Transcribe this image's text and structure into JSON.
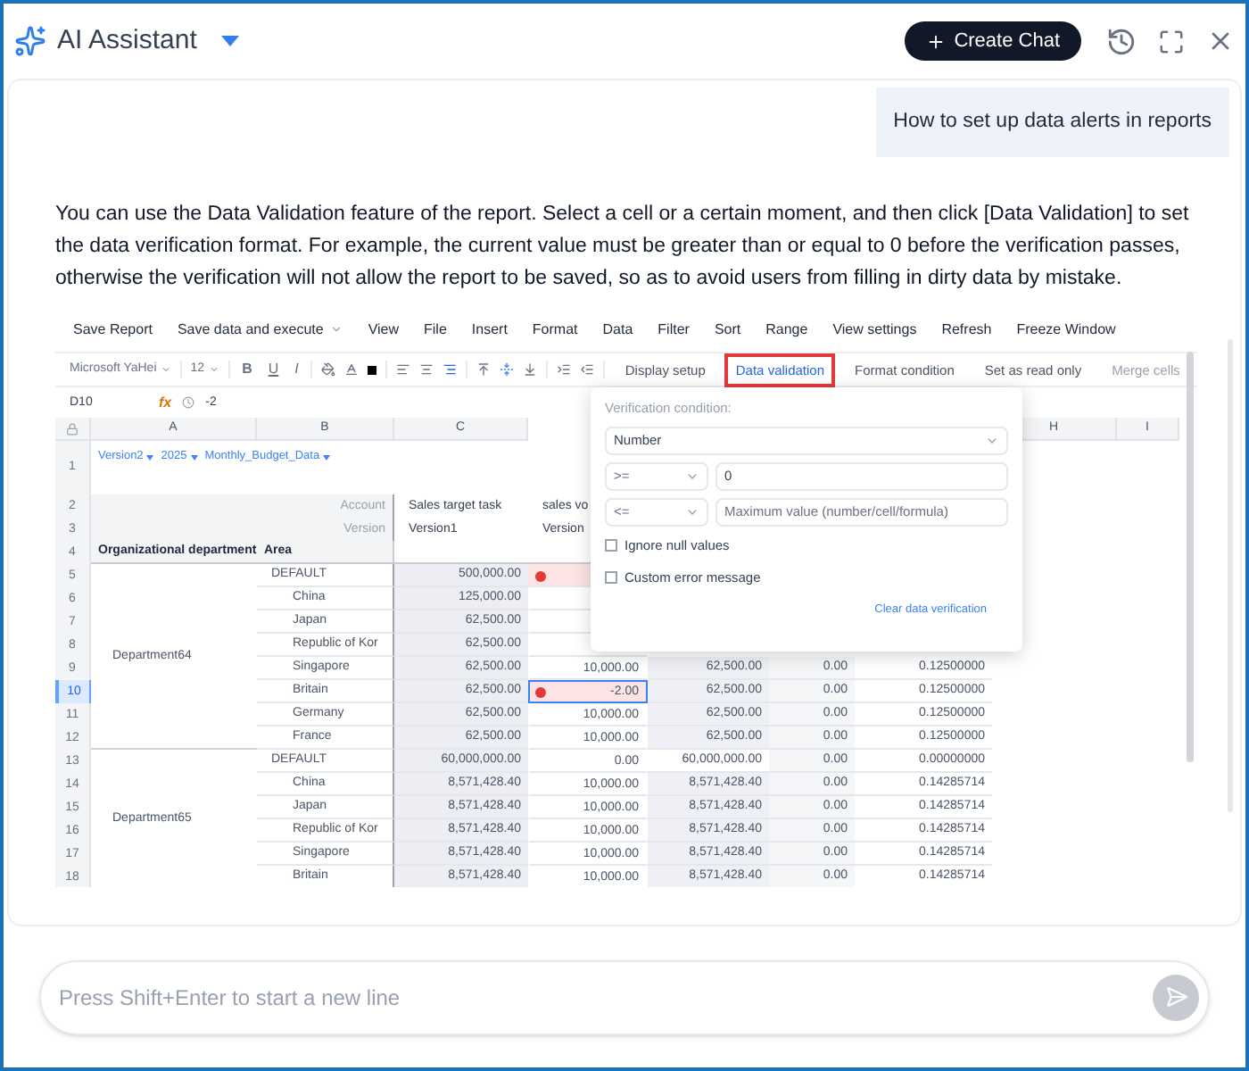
{
  "header": {
    "title": "AI Assistant",
    "create_chat": "Create Chat"
  },
  "chat": {
    "user_message": "How to set up data alerts in reports",
    "answer": "You can use the Data Validation feature of the report. Select a cell or a certain moment, and then click [Data Validation] to set the data verification format. For example, the current value must be greater than or equal to 0 before the verification passes, otherwise the verification will not allow the report to be saved, so as to avoid users from filling in dirty data by mistake.",
    "sheet": {
      "menu": [
        {
          "label": "Save Report",
          "dropdown": false
        },
        {
          "label": "Save data and execute",
          "dropdown": true
        },
        {
          "label": "View",
          "dropdown": false
        },
        {
          "label": "File",
          "dropdown": false
        },
        {
          "label": "Insert",
          "dropdown": false
        },
        {
          "label": "Format",
          "dropdown": false
        },
        {
          "label": "Data",
          "dropdown": false
        },
        {
          "label": "Filter",
          "dropdown": false
        },
        {
          "label": "Sort",
          "dropdown": false
        },
        {
          "label": "Range",
          "dropdown": false
        },
        {
          "label": "View settings",
          "dropdown": false
        },
        {
          "label": "Refresh",
          "dropdown": false
        },
        {
          "label": "Freeze Window",
          "dropdown": false
        }
      ],
      "font": "Microsoft YaHei",
      "font_size": "12",
      "format_buttons": [
        "B",
        "U",
        "I"
      ],
      "tools": [
        {
          "label": "Display setup",
          "selected": false,
          "disabled": false
        },
        {
          "label": "Data validation",
          "selected": true,
          "disabled": false
        },
        {
          "label": "Format condition",
          "selected": false,
          "disabled": false
        },
        {
          "label": "Set as read only",
          "selected": false,
          "disabled": false
        },
        {
          "label": "Merge cells",
          "selected": false,
          "disabled": true
        }
      ],
      "cell_ref": "D10",
      "fx_label": "fx",
      "formula": "-2",
      "columns": [
        {
          "kind": "letter",
          "label": "A"
        },
        {
          "kind": "letter",
          "label": "B"
        },
        {
          "kind": "letter",
          "label": "C"
        },
        {
          "kind": "covered"
        },
        {
          "kind": "covered"
        },
        {
          "kind": "covered"
        },
        {
          "kind": "covered"
        },
        {
          "kind": "letter",
          "label": "H"
        },
        {
          "kind": "letter",
          "label": "I"
        }
      ],
      "filter_row": {
        "number": "1",
        "filters": [
          "Version2",
          "2025",
          "Monthly_Budget_Data"
        ]
      },
      "header_rows": [
        {
          "number": "2",
          "b": "Account",
          "c": "Sales target task",
          "d": "sales vo"
        },
        {
          "number": "3",
          "b": "Version",
          "c": "Version1",
          "d": "Version"
        },
        {
          "number": "4",
          "a": "Organizational department",
          "b": "Area"
        }
      ],
      "groups": [
        {
          "department": "Department64",
          "rows": [
            {
              "number": "5",
              "kind": "default",
              "area": "DEFAULT",
              "values": [
                "500,000.00"
              ],
              "error": true,
              "selected": false
            },
            {
              "number": "6",
              "kind": "area",
              "area": "China",
              "values": [
                "125,000.00"
              ],
              "error": false,
              "selected": false
            },
            {
              "number": "7",
              "kind": "area",
              "area": "Japan",
              "values": [
                "62,500.00"
              ],
              "error": false,
              "selected": false
            },
            {
              "number": "8",
              "kind": "area",
              "area": "Republic of Kor",
              "values": [
                "62,500.00"
              ],
              "error": false,
              "selected": false
            },
            {
              "number": "9",
              "kind": "area",
              "area": "Singapore",
              "values": [
                "62,500.00",
                "10,000.00",
                "62,500.00",
                "0.00",
                "0.12500000"
              ],
              "error": false,
              "selected": false
            },
            {
              "number": "10",
              "kind": "area",
              "area": "Britain",
              "values": [
                "62,500.00",
                "-2.00",
                "62,500.00",
                "0.00",
                "0.12500000"
              ],
              "error": true,
              "selected": true
            },
            {
              "number": "11",
              "kind": "area",
              "area": "Germany",
              "values": [
                "62,500.00",
                "10,000.00",
                "62,500.00",
                "0.00",
                "0.12500000"
              ],
              "error": false,
              "selected": false
            },
            {
              "number": "12",
              "kind": "area",
              "area": "France",
              "values": [
                "62,500.00",
                "10,000.00",
                "62,500.00",
                "0.00",
                "0.12500000"
              ],
              "error": false,
              "selected": false
            }
          ]
        },
        {
          "department": "Department65",
          "rows": [
            {
              "number": "13",
              "kind": "default",
              "area": "DEFAULT",
              "values": [
                "60,000,000.00",
                "0.00",
                "60,000,000.00",
                "0.00",
                "0.00000000"
              ],
              "error": false,
              "selected": false
            },
            {
              "number": "14",
              "kind": "area",
              "area": "China",
              "values": [
                "8,571,428.40",
                "10,000.00",
                "8,571,428.40",
                "0.00",
                "0.14285714"
              ],
              "error": false,
              "selected": false
            },
            {
              "number": "15",
              "kind": "area",
              "area": "Japan",
              "values": [
                "8,571,428.40",
                "10,000.00",
                "8,571,428.40",
                "0.00",
                "0.14285714"
              ],
              "error": false,
              "selected": false
            },
            {
              "number": "16",
              "kind": "area",
              "area": "Republic of Kor",
              "values": [
                "8,571,428.40",
                "10,000.00",
                "8,571,428.40",
                "0.00",
                "0.14285714"
              ],
              "error": false,
              "selected": false
            },
            {
              "number": "17",
              "kind": "area",
              "area": "Singapore",
              "values": [
                "8,571,428.40",
                "10,000.00",
                "8,571,428.40",
                "0.00",
                "0.14285714"
              ],
              "error": false,
              "selected": false
            },
            {
              "number": "18",
              "kind": "area",
              "area": "Britain",
              "values": [
                "8,571,428.40",
                "10,000.00",
                "8,571,428.40",
                "0.00",
                "0.14285714"
              ],
              "error": false,
              "selected": false
            }
          ]
        }
      ],
      "popup": {
        "title": "Verification condition:",
        "type": "Number",
        "conditions": [
          {
            "operator": ">=",
            "value": "0"
          },
          {
            "operator": "<=",
            "placeholder": "Maximum value (number/cell/formula)"
          }
        ],
        "options": [
          {
            "label": "Ignore null values",
            "checked": false
          },
          {
            "label": "Custom error message",
            "checked": false
          }
        ],
        "clear_link": "Clear data verification"
      }
    }
  },
  "input": {
    "placeholder": "Press Shift+Enter to start a new line"
  }
}
